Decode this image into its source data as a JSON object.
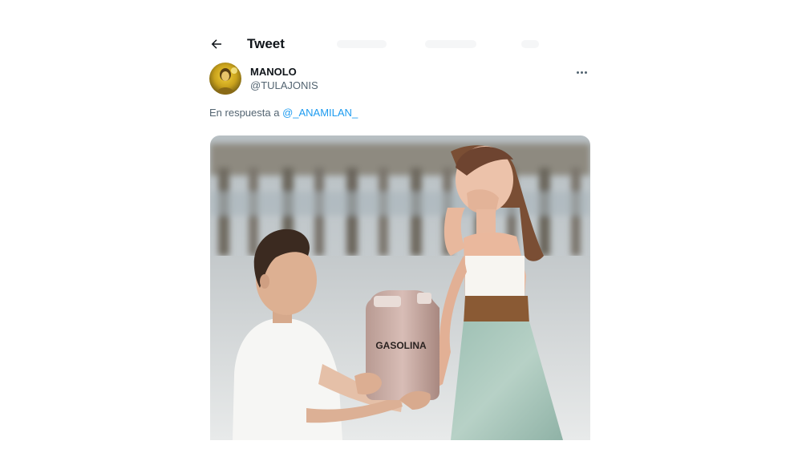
{
  "header": {
    "title": "Tweet"
  },
  "tweet": {
    "author_name": "MANOLO",
    "author_handle": "@TULAJONIS",
    "reply_prefix": "En respuesta a ",
    "reply_to": "@_ANAMILAN_",
    "media": {
      "jug_label": "GASOLINA"
    }
  }
}
